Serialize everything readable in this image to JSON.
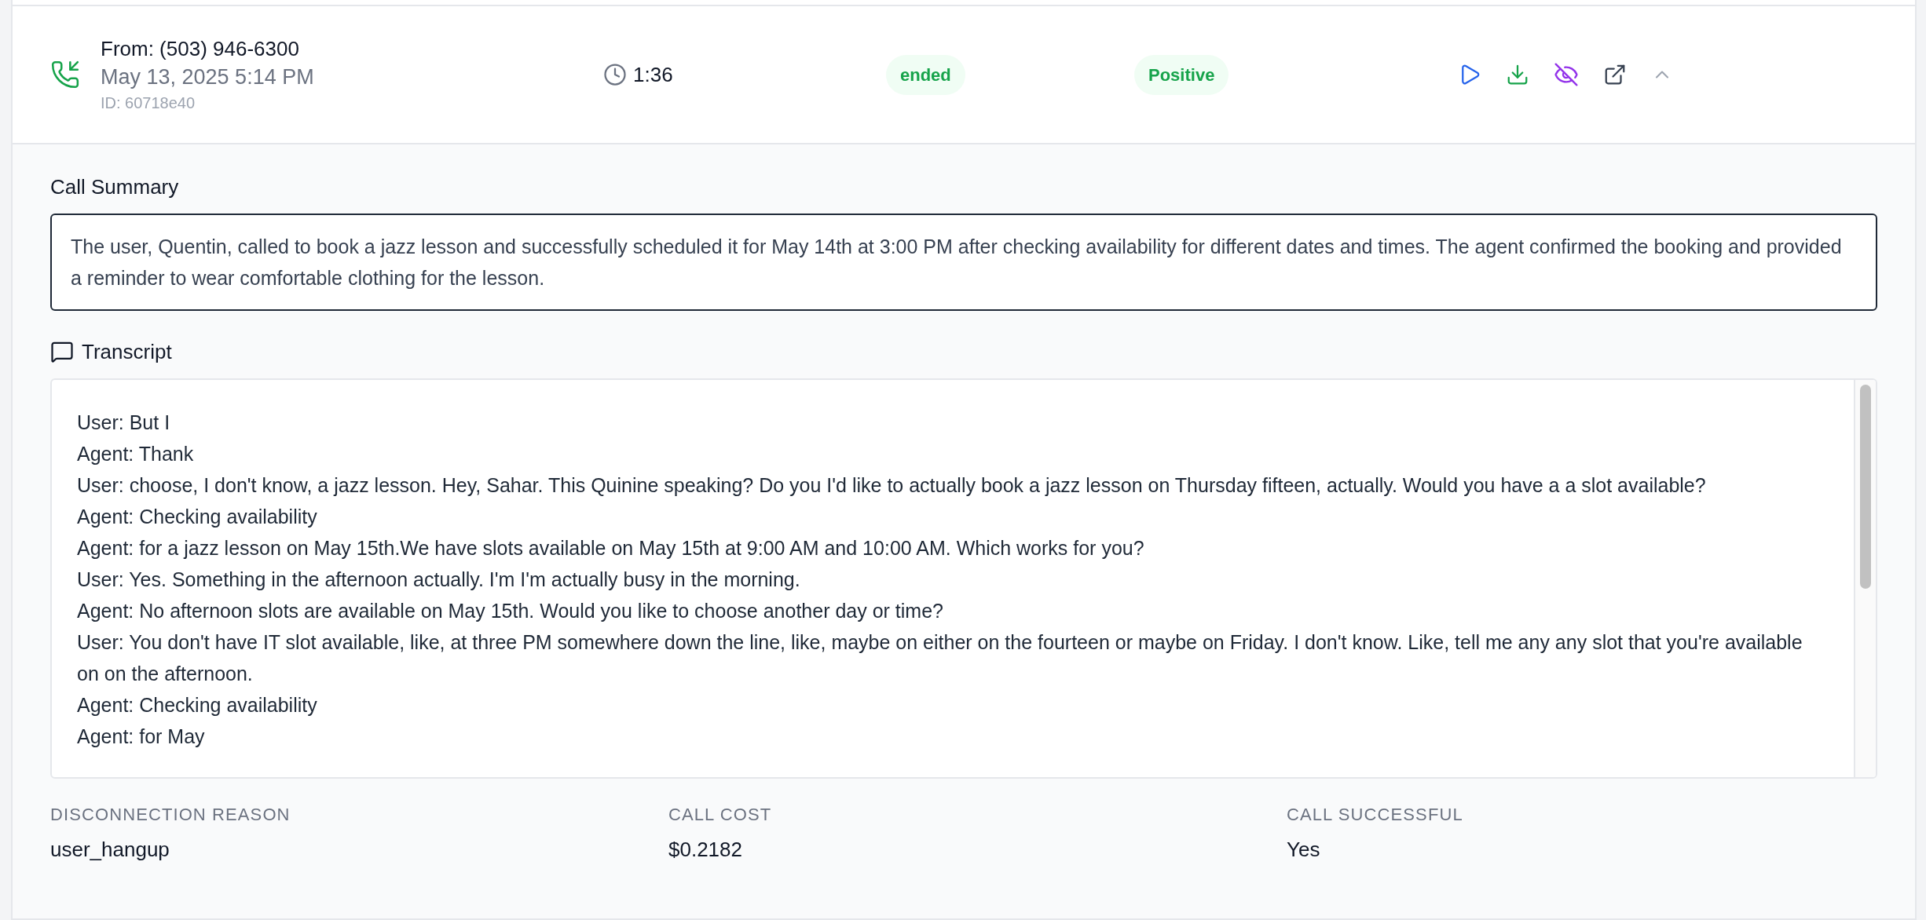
{
  "call": {
    "from": "From: (503) 946-6300",
    "date": "May 13, 2025 5:14 PM",
    "id": "ID: 60718e40",
    "duration": "1:36",
    "status": "ended",
    "sentiment": "Positive",
    "expanded": true
  },
  "summary": {
    "title": "Call Summary",
    "text": "The user, Quentin, called to book a jazz lesson and successfully scheduled it for May 14th at 3:00 PM after checking availability for different dates and times. The agent confirmed the booking and provided a reminder to wear comfortable clothing for the lesson."
  },
  "transcript": {
    "title": "Transcript",
    "lines": [
      "User: But I",
      "Agent: Thank",
      "User: choose, I don't know, a jazz lesson. Hey, Sahar. This Quinine speaking? Do you I'd like to actually book a jazz lesson on Thursday fifteen, actually. Would you have a a slot available?",
      "Agent: Checking availability",
      "Agent: for a jazz lesson on May 15th.We have slots available on May 15th at 9:00 AM and 10:00 AM. Which works for you?",
      "User: Yes. Something in the afternoon actually. I'm I'm actually busy in the morning.",
      "Agent: No afternoon slots are available on May 15th. Would you like to choose another day or time?",
      "User: You don't have IT slot available, like, at three PM somewhere down the line, like, maybe on either on the fourteen or maybe on Friday. I don't know. Like, tell me any any slot that you're available on on the afternoon.",
      "Agent: Checking availability",
      "Agent: for May"
    ]
  },
  "details": [
    {
      "label": "DISCONNECTION REASON",
      "value": "user_hangup"
    },
    {
      "label": "CALL COST",
      "value": "$0.2182"
    },
    {
      "label": "CALL SUCCESSFUL",
      "value": "Yes"
    }
  ]
}
